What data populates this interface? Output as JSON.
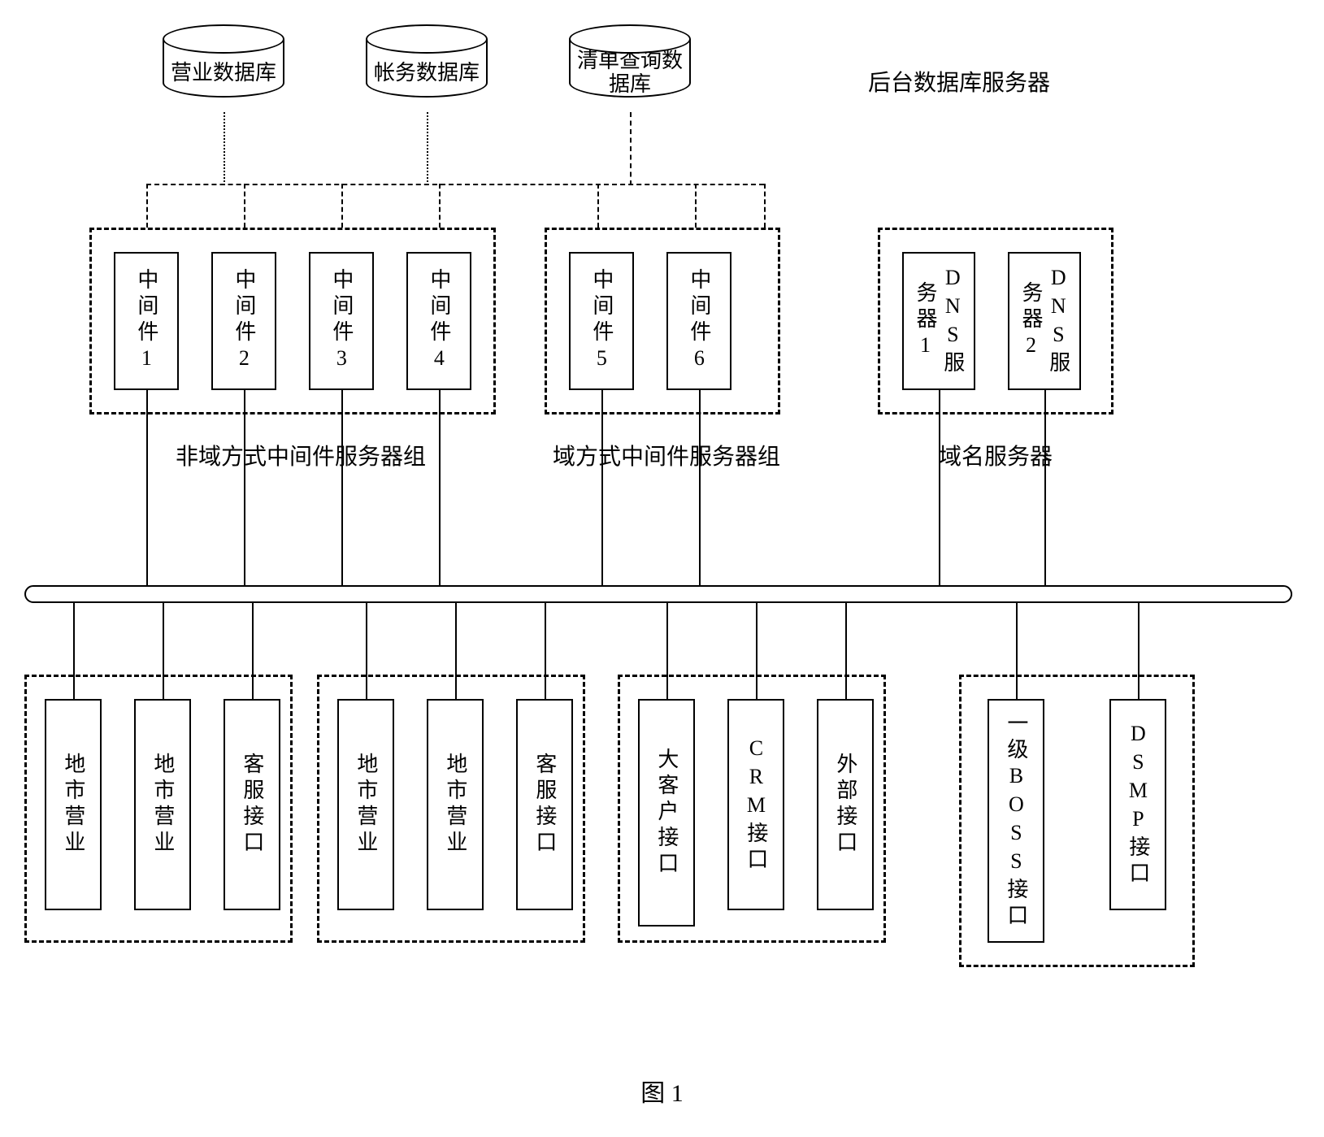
{
  "databases": {
    "db1": "营业数据库",
    "db2": "帐务数据库",
    "db3": "清单查询数据库"
  },
  "topRightLabel": "后台数据库服务器",
  "middleware": {
    "m1": "中间件1",
    "m2": "中间件2",
    "m3": "中间件3",
    "m4": "中间件4",
    "m5": "中间件5",
    "m6": "中间件6"
  },
  "dns": {
    "d1": "DNS服务器1",
    "d2": "DNS服务器2"
  },
  "groupLabels": {
    "nonDomain": "非域方式中间件服务器组",
    "domain": "域方式中间件服务器组",
    "dns": "域名服务器"
  },
  "clients": {
    "c1": "地市营业",
    "c2": "地市营业",
    "c3": "客服接口",
    "c4": "地市营业",
    "c5": "地市营业",
    "c6": "客服接口",
    "c7": "大客户接口",
    "c8": "CRM接口",
    "c9": "外部接口",
    "c10": "一级BOSS接口",
    "c11": "DSMP接口"
  },
  "figure": "图 1"
}
